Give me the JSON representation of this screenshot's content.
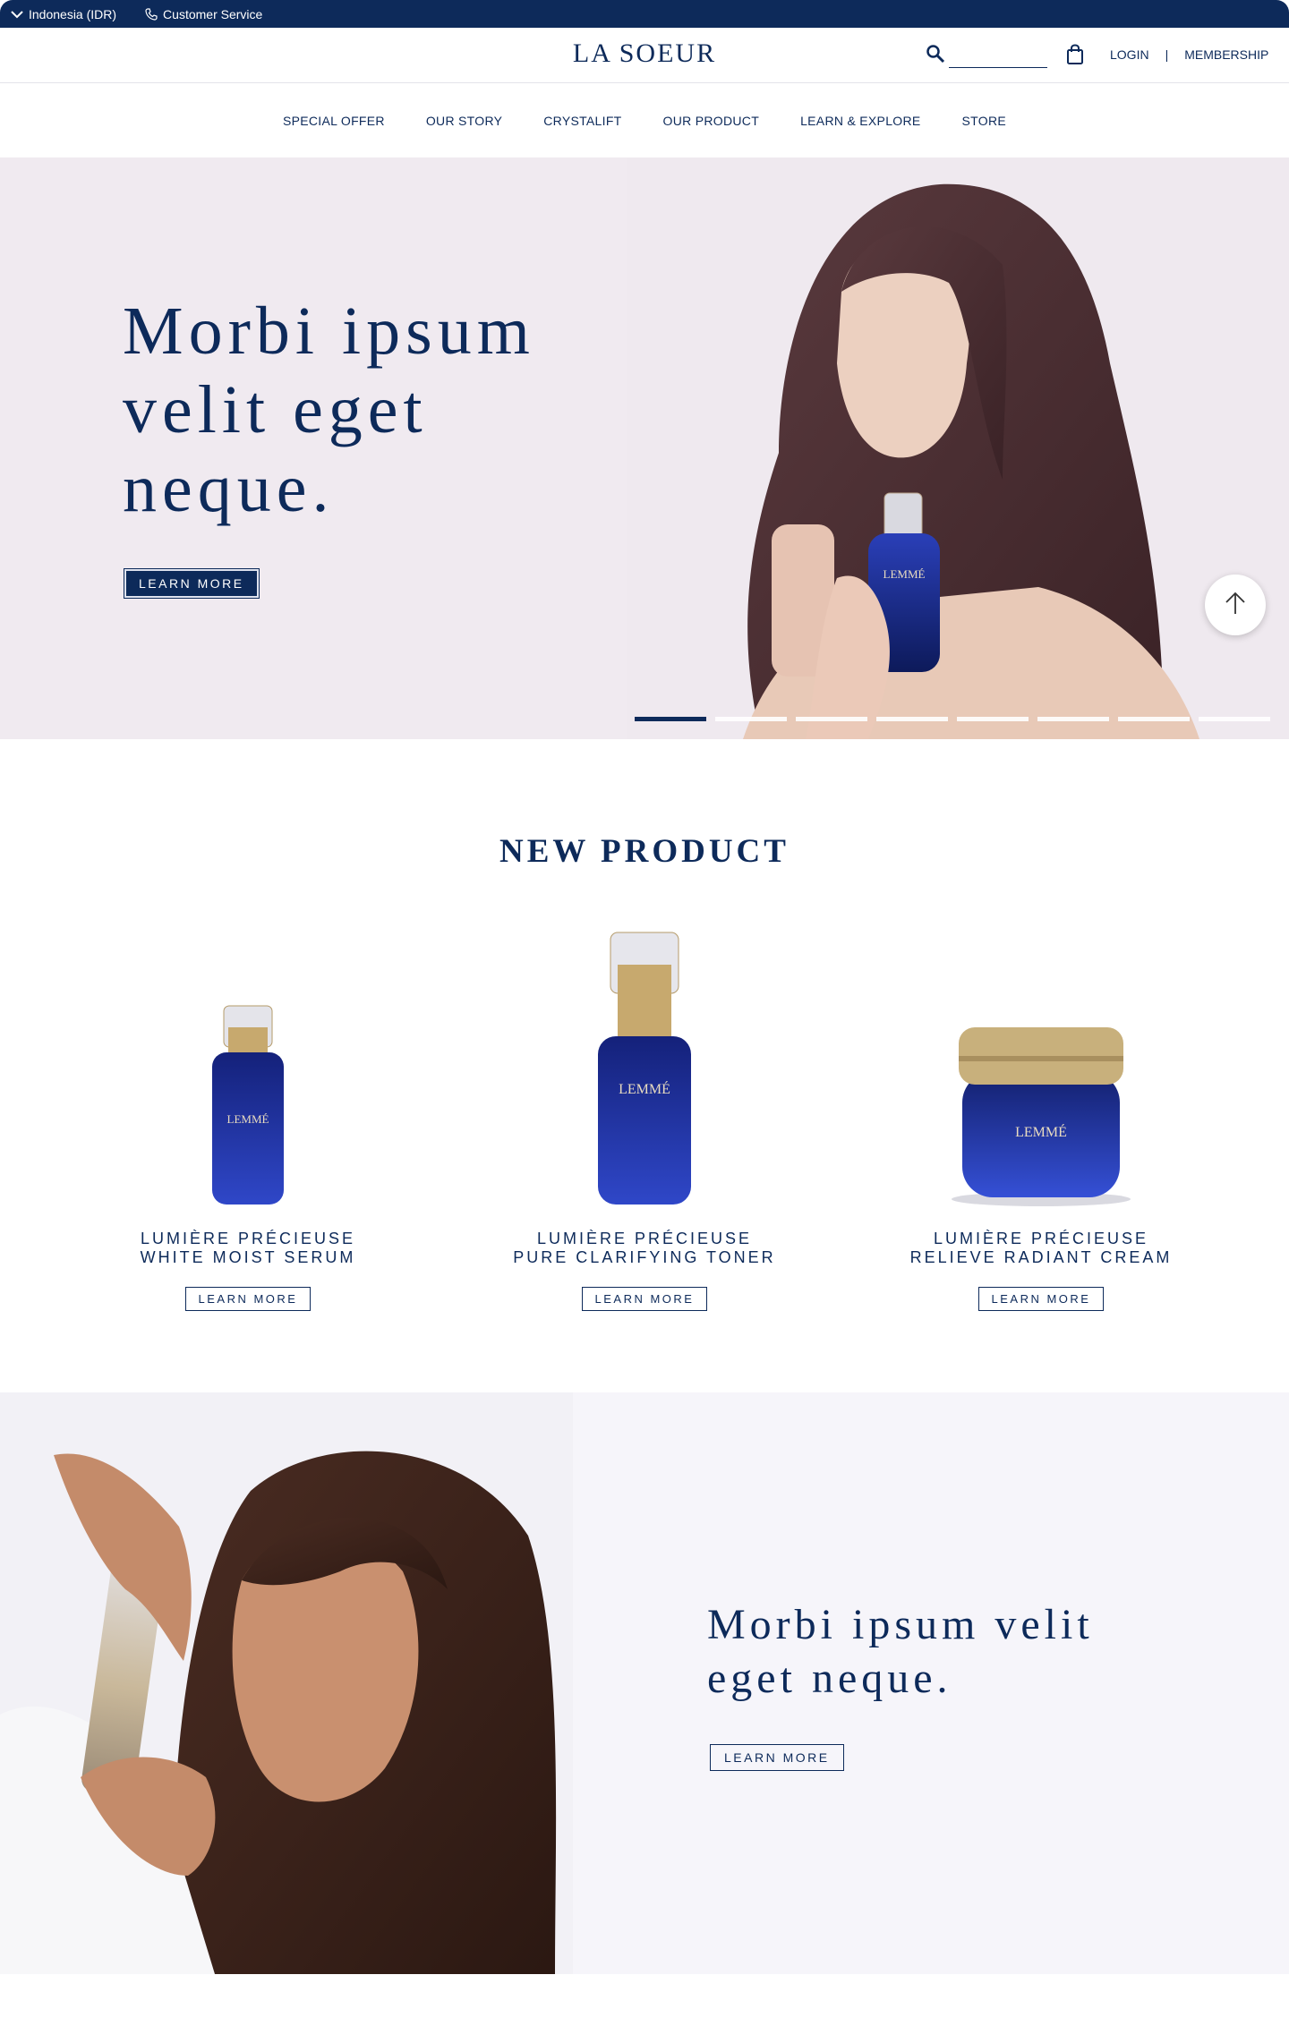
{
  "topbar": {
    "region": "Indonesia (IDR)",
    "service": "Customer Service"
  },
  "header": {
    "logo": "LA SOEUR",
    "search_value": "",
    "login": "LOGIN",
    "divider": "|",
    "membership": "MEMBERSHIP"
  },
  "nav": {
    "items": [
      "SPECIAL OFFER",
      "OUR STORY",
      "CRYSTALIFT",
      "OUR PRODUCT",
      "LEARN & EXPLORE",
      "STORE"
    ]
  },
  "hero": {
    "title": "Morbi ipsum velit eget neque.",
    "cta": "LEARN MORE",
    "slides_total": 8,
    "active_slide": 1
  },
  "new_product": {
    "title": "NEW PRODUCT",
    "items": [
      {
        "line1": "LUMIÈRE PRÉCIEUSE",
        "line2": "WHITE MOIST SERUM",
        "cta": "LEARN MORE",
        "bottle_brand": "LEMMÉ"
      },
      {
        "line1": "LUMIÈRE PRÉCIEUSE",
        "line2": "PURE CLARIFYING TONER",
        "cta": "LEARN MORE",
        "bottle_brand": "LEMMÉ"
      },
      {
        "line1": "LUMIÈRE PRÉCIEUSE",
        "line2": "RELIEVE RADIANT CREAM",
        "cta": "LEARN MORE",
        "bottle_brand": "LEMMÉ"
      }
    ]
  },
  "banner2": {
    "title": "Morbi ipsum velit eget neque.",
    "cta": "LEARN MORE"
  },
  "colors": {
    "navy": "#0d2a5a",
    "hero_bg": "#f0eaf0",
    "banner_bg": "#f6f5fa",
    "bottle_blue": "#1b2d8a",
    "gold": "#b59b6a"
  },
  "icons": [
    "chevron-down-icon",
    "phone-icon",
    "search-icon",
    "bag-icon",
    "arrow-up-icon"
  ]
}
